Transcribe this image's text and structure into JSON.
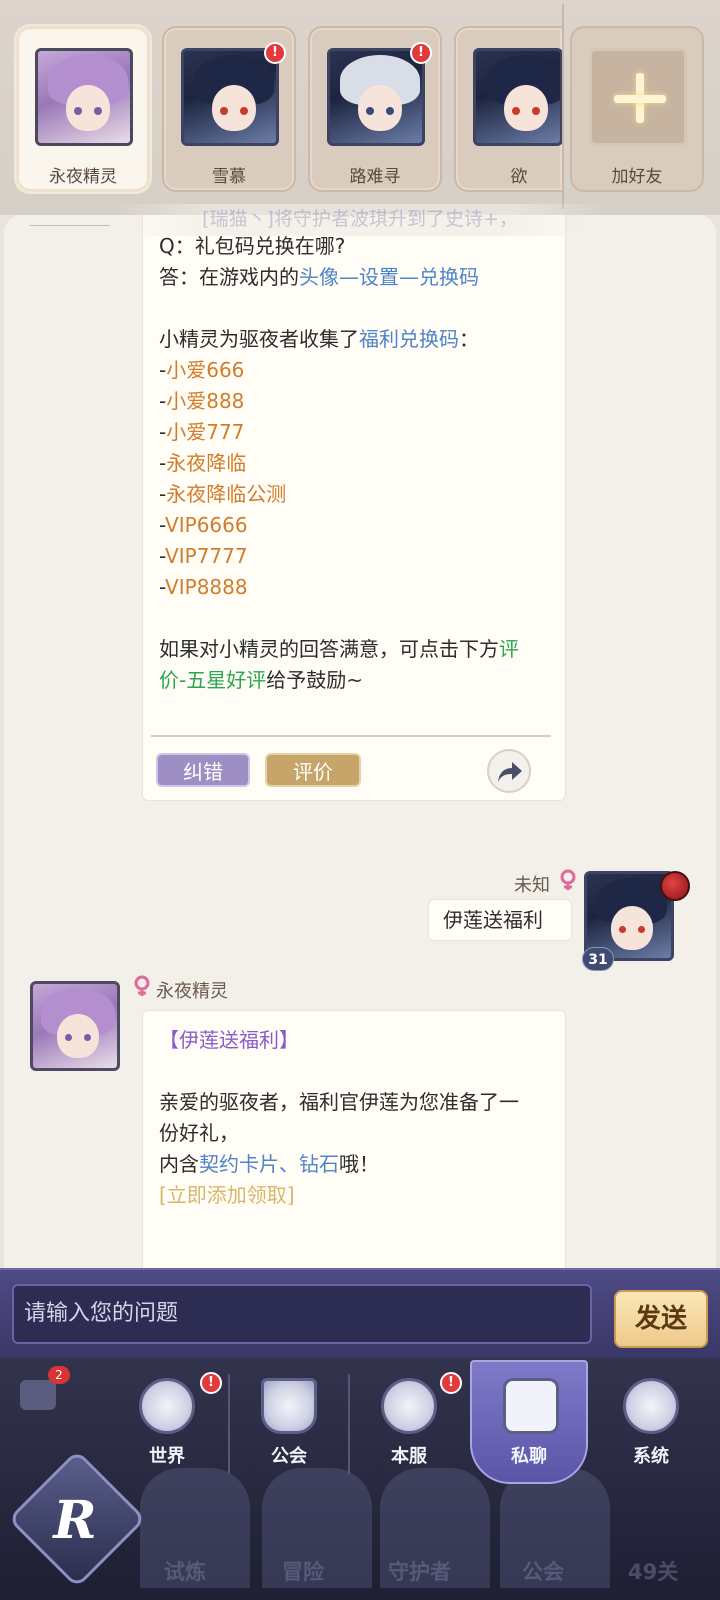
{
  "friends": [
    {
      "name": "永夜精灵",
      "active": true,
      "alert": false
    },
    {
      "name": "雪慕",
      "active": false,
      "alert": true
    },
    {
      "name": "路难寻",
      "active": false,
      "alert": true
    },
    {
      "name": "欲",
      "active": false,
      "alert": false
    }
  ],
  "add_friend_label": "加好友",
  "marquee_text": "[瑞猫丶]将守护者波琪升到了史诗+，",
  "message1": {
    "q_line": "Q：礼包码兑换在哪?",
    "a_prefix": "答：在游戏内的",
    "a_link": "头像—设置—兑换码",
    "intro_prefix": "小精灵为驱夜者收集了",
    "intro_link": "福利兑换码",
    "intro_suffix": "：",
    "codes": [
      "小爱666",
      "小爱888",
      "小爱777",
      "永夜降临",
      "永夜降临公测",
      "VIP6666",
      "VIP7777",
      "VIP8888"
    ],
    "feedback_prefix": "如果对小精灵的回答满意，可点击下方",
    "feedback_link_1": "评",
    "feedback_link_2": "价-五星好评",
    "feedback_suffix": "给予鼓励~",
    "fix_button": "纠错",
    "rate_button": "评价"
  },
  "message2": {
    "sender": "未知",
    "text": "伊莲送福利",
    "level": "31"
  },
  "message3": {
    "sender": "永夜精灵",
    "title": "【伊莲送福利】",
    "body_line1": "亲爱的驱夜者，福利官伊莲为您准备了一",
    "body_line2": "份好礼，",
    "body_prefix": "内含",
    "body_link": "契约卡片、钻石",
    "body_suffix": "哦！",
    "claim_link": "[立即添加领取]"
  },
  "input": {
    "placeholder": "请输入您的问题",
    "send_label": "发送"
  },
  "tabs": [
    {
      "label": "世界",
      "alert": true,
      "active": false
    },
    {
      "label": "公会",
      "alert": false,
      "active": false
    },
    {
      "label": "本服",
      "alert": true,
      "active": false
    },
    {
      "label": "私聊",
      "alert": false,
      "active": true
    },
    {
      "label": "系统",
      "alert": false,
      "active": false
    }
  ],
  "background_nav": {
    "labels": [
      "试炼",
      "冒险",
      "守护者",
      "公会"
    ],
    "chat_count": "2",
    "level_text": "49关"
  },
  "colors": {
    "link_blue": "#4f84c9",
    "code_orange": "#d27d2c",
    "rating_green": "#2aa84e",
    "title_purple": "#8a5cc7",
    "claim_gold": "#d8b66a",
    "alert_red": "#e23a3a"
  }
}
